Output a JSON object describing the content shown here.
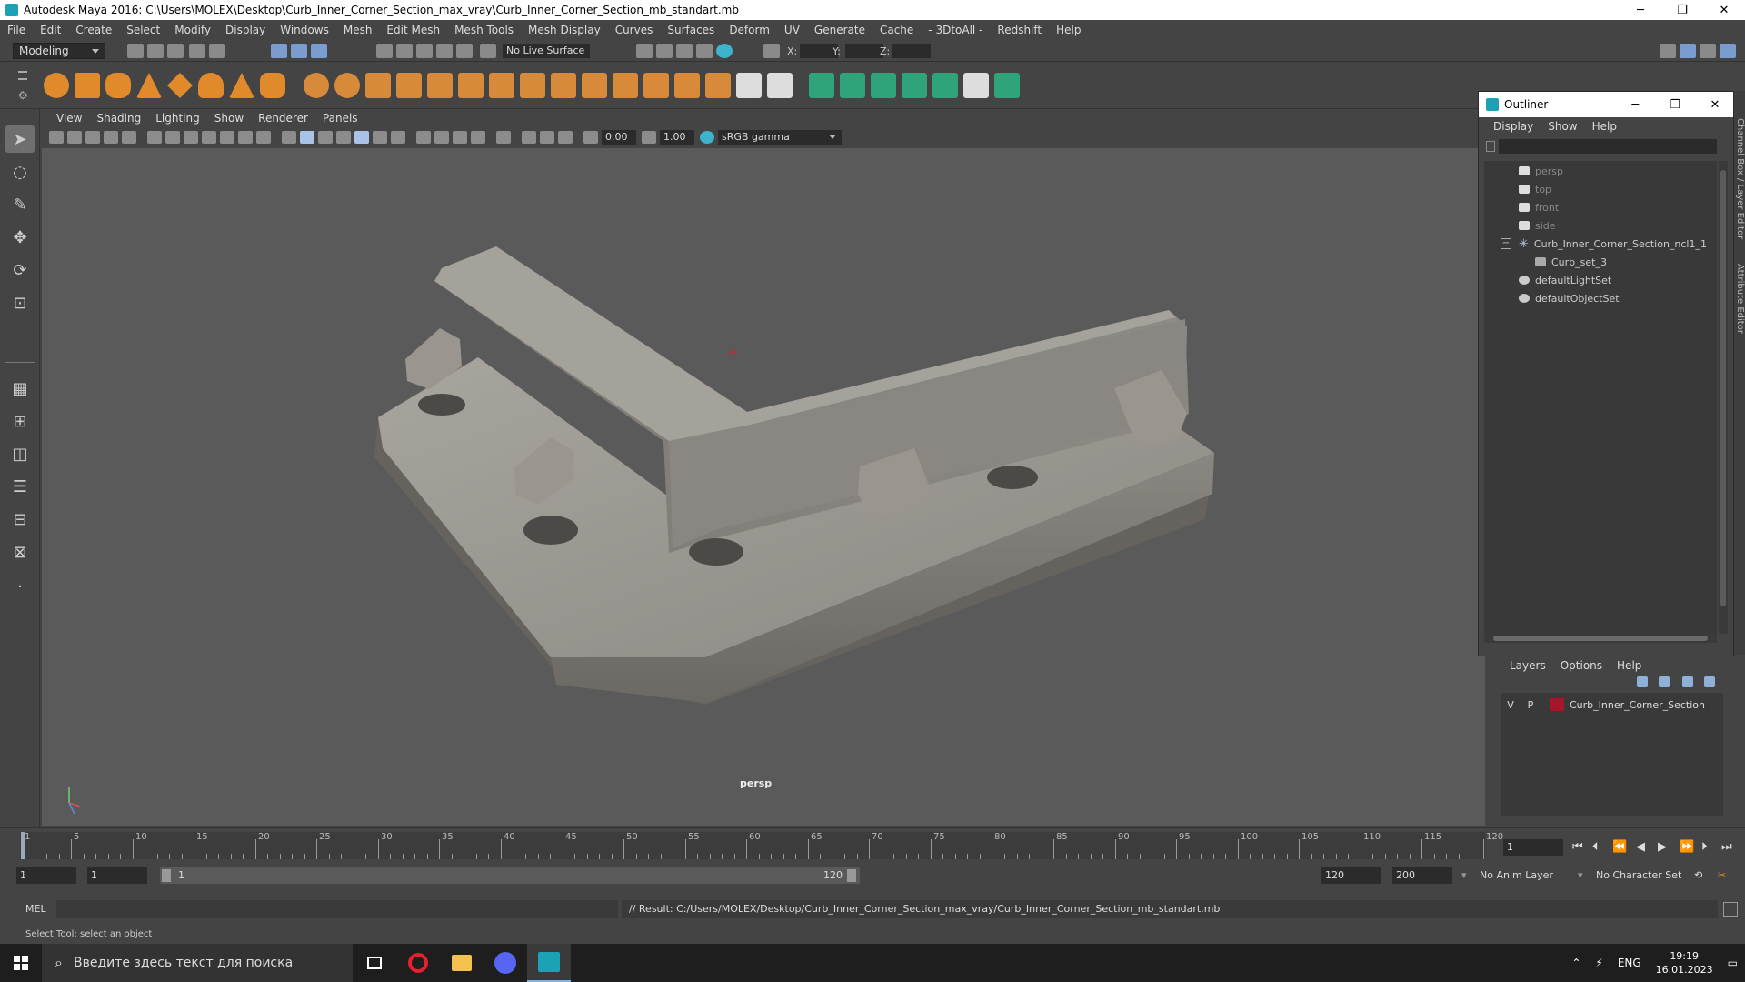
{
  "window": {
    "title": "Autodesk Maya 2016: C:\\Users\\MOLEX\\Desktop\\Curb_Inner_Corner_Section_max_vray\\Curb_Inner_Corner_Section_mb_standart.mb",
    "minimize": "─",
    "restore": "❐",
    "close": "✕"
  },
  "menubar": [
    "File",
    "Edit",
    "Create",
    "Select",
    "Modify",
    "Display",
    "Windows",
    "Mesh",
    "Edit Mesh",
    "Mesh Tools",
    "Mesh Display",
    "Curves",
    "Surfaces",
    "Deform",
    "UV",
    "Generate",
    "Cache",
    "- 3DtoAll -",
    "Redshift",
    "Help"
  ],
  "status": {
    "mode": "Modeling",
    "live_surface": "No Live Surface",
    "x_label": "X:",
    "y_label": "Y:",
    "z_label": "Z:"
  },
  "viewport": {
    "menu": [
      "View",
      "Shading",
      "Lighting",
      "Show",
      "Renderer",
      "Panels"
    ],
    "exposure": "0.00",
    "gamma_value": "1.00",
    "color_space": "sRGB gamma",
    "camera_label": "persp"
  },
  "outliner": {
    "title": "Outliner",
    "menu": [
      "Display",
      "Show",
      "Help"
    ],
    "items": [
      {
        "label": "persp",
        "type": "camera",
        "muted": true
      },
      {
        "label": "top",
        "type": "camera",
        "muted": true
      },
      {
        "label": "front",
        "type": "camera",
        "muted": true
      },
      {
        "label": "side",
        "type": "camera",
        "muted": true
      },
      {
        "label": "Curb_Inner_Corner_Section_ncl1_1",
        "type": "group",
        "muted": false
      },
      {
        "label": "Curb_set_3",
        "type": "set",
        "muted": false
      },
      {
        "label": "defaultLightSet",
        "type": "set",
        "muted": false
      },
      {
        "label": "defaultObjectSet",
        "type": "set",
        "muted": false
      }
    ],
    "collapse_glyph": "−"
  },
  "layers": {
    "menu": [
      "Layers",
      "Options",
      "Help"
    ],
    "rows": [
      {
        "v": "V",
        "p": "P",
        "name": "Curb_Inner_Corner_Section",
        "color": "#a8152b"
      }
    ]
  },
  "side_tabs": [
    "Channel Box / Layer Editor",
    "Attribute Editor"
  ],
  "timeline": {
    "ticks": [
      1,
      5,
      10,
      15,
      20,
      25,
      30,
      35,
      40,
      45,
      50,
      55,
      60,
      65,
      70,
      75,
      80,
      85,
      90,
      95,
      100,
      105,
      110,
      115,
      120
    ],
    "current_frame": "1"
  },
  "range": {
    "start": "1",
    "playback_start": "1",
    "slider_start": "1",
    "slider_end": "120",
    "playback_end": "120",
    "end": "200",
    "anim_layer": "No Anim Layer",
    "character_set": "No Character Set"
  },
  "command": {
    "label": "MEL",
    "result": "// Result: C:/Users/MOLEX/Desktop/Curb_Inner_Corner_Section_max_vray/Curb_Inner_Corner_Section_mb_standart.mb"
  },
  "help_line": "Select Tool: select an object",
  "taskbar": {
    "search_placeholder": "Введите здесь текст для поиска",
    "lang": "ENG",
    "time": "19:19",
    "date": "16.01.2023"
  },
  "colors": {
    "accent": "#1ba2b5",
    "layer_swatch": "#a8152b",
    "manipulator": "#cc2244"
  }
}
